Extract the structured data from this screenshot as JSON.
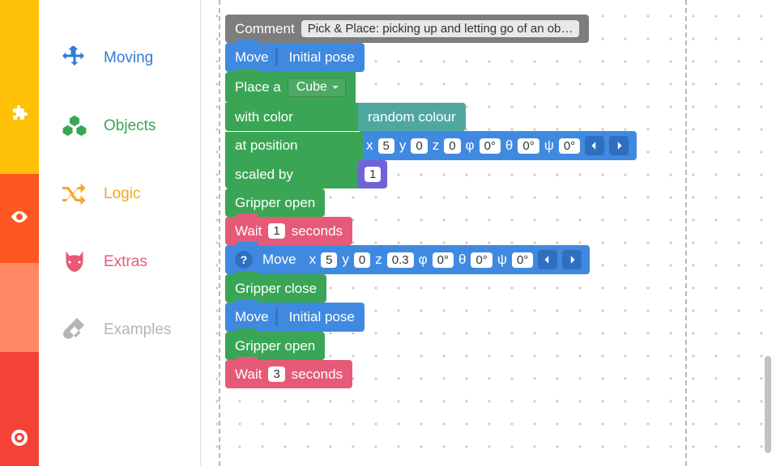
{
  "toolbox": [
    {
      "label": "Moving",
      "icon": "move"
    },
    {
      "label": "Objects",
      "icon": "cubes"
    },
    {
      "label": "Logic",
      "icon": "shuffle"
    },
    {
      "label": "Extras",
      "icon": "cat"
    },
    {
      "label": "Examples",
      "icon": "tube"
    }
  ],
  "rail_icons": [
    "puzzle",
    "eye",
    "eye",
    "help"
  ],
  "blocks": {
    "comment": {
      "label": "Comment",
      "text": "Pick & Place: picking up and letting go of an ob…"
    },
    "move1": {
      "label": "Move",
      "target": "Initial pose"
    },
    "place": {
      "place_label": "Place a",
      "shape": "Cube",
      "with_color": "with color",
      "color_val": "random colour",
      "at_position": "at position",
      "coords": {
        "x_l": "x",
        "x": "5",
        "y_l": "y",
        "y": "0",
        "z_l": "z",
        "z": "0",
        "phi_l": "φ",
        "phi": "0°",
        "theta_l": "θ",
        "theta": "0°",
        "psi_l": "ψ",
        "psi": "0°"
      },
      "scaled_by": "scaled by",
      "scale": "1"
    },
    "gripper_open1": "Gripper open",
    "wait1": {
      "label": "Wait",
      "n": "1",
      "unit": "seconds"
    },
    "move2": {
      "label": "Move",
      "coords": {
        "x_l": "x",
        "x": "5",
        "y_l": "y",
        "y": "0",
        "z_l": "z",
        "z": "0.3",
        "phi_l": "φ",
        "phi": "0°",
        "theta_l": "θ",
        "theta": "0°",
        "psi_l": "ψ",
        "psi": "0°"
      }
    },
    "gripper_close": "Gripper close",
    "move3": {
      "label": "Move",
      "target": "Initial pose"
    },
    "gripper_open2": "Gripper open",
    "wait2": {
      "label": "Wait",
      "n": "3",
      "unit": "seconds"
    }
  }
}
